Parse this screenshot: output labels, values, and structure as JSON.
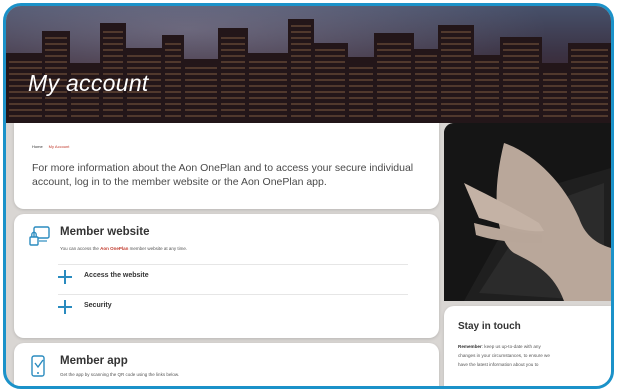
{
  "hero": {
    "title": "My account"
  },
  "breadcrumb": {
    "home": "Home",
    "current": "My Account"
  },
  "intro": "For more information about the Aon OnePlan and to access your secure individual account, log in to the member website or the Aon OnePlan app.",
  "member_website": {
    "title": "Member website",
    "desc_prefix": "You can access the ",
    "desc_brand": "Aon OnePlan",
    "desc_suffix": " member website at any time.",
    "items": [
      {
        "label": "Access the website"
      },
      {
        "label": "Security"
      }
    ]
  },
  "member_app": {
    "title": "Member app",
    "desc": "Get the app by scanning the QR code using the links below."
  },
  "stay_in_touch": {
    "title": "Stay in touch",
    "line1_bold": "Remember",
    "line1_rest": ": keep us up-to-date with any",
    "line2": "changes in your circumstances, to ensure we",
    "line3": "have the latest information about you to"
  },
  "colors": {
    "accent": "#1b92c9",
    "brand_red": "#c0392b",
    "plus_blue": "#2a8bbf"
  },
  "icons": [
    "monitor-lock-icon",
    "phone-app-icon",
    "plus-icon"
  ]
}
